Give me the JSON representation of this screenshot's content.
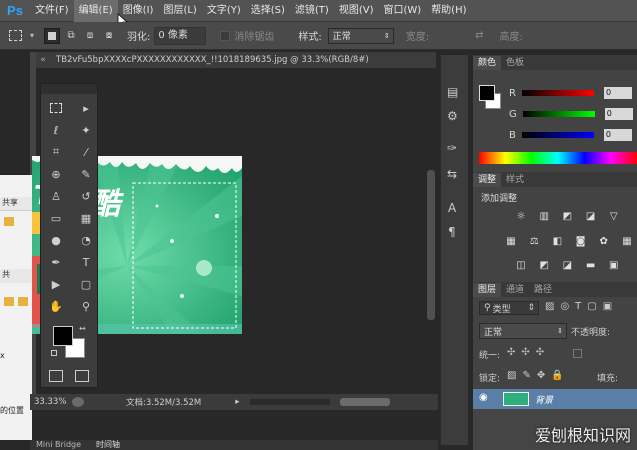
{
  "app": {
    "logo": "Ps"
  },
  "menu": [
    "文件(F)",
    "编辑(E)",
    "图像(I)",
    "图层(L)",
    "文字(Y)",
    "选择(S)",
    "滤镜(T)",
    "视图(V)",
    "窗口(W)",
    "帮助(H)"
  ],
  "active_menu_index": 1,
  "options": {
    "feather_label": "羽化:",
    "feather_value": "0 像素",
    "antialias_label": "消除锯齿",
    "style_label": "样式:",
    "style_value": "正常",
    "width_label": "宽度:",
    "height_label": "高度:"
  },
  "document": {
    "tab_title": "TB2vFu5bpXXXXcPXXXXXXXXXXXX_!!1018189635.jpg @ 33.3%(RGB/8#)",
    "zoom": "33.33%",
    "doc_info": "文档:3.52M/3.52M"
  },
  "bottom_tabs": [
    "Mini Bridge",
    "时间轴"
  ],
  "left_window_text": [
    "共享",
    "共",
    "x",
    "的位置"
  ],
  "color_panel": {
    "tabs": [
      "颜色",
      "色板"
    ],
    "channels": [
      {
        "label": "R",
        "value": "0"
      },
      {
        "label": "G",
        "value": "0"
      },
      {
        "label": "B",
        "value": "0"
      }
    ]
  },
  "adjust_panel": {
    "tabs": [
      "调整",
      "样式"
    ],
    "title": "添加调整"
  },
  "layers_panel": {
    "tabs": [
      "图层",
      "通道",
      "路径"
    ],
    "kind_label": "类型",
    "blend_mode": "正常",
    "opacity_label": "不透明度:",
    "lock_label": "锁定:",
    "unify_label": "统一:",
    "fill_label": "填充:",
    "layer_name": "背景"
  },
  "watermark": "爱刨根知识网",
  "colors": {
    "accent_ps": "#2fa3f5",
    "image_green": "#2db07b",
    "layer_selected": "#5a7fa6"
  }
}
